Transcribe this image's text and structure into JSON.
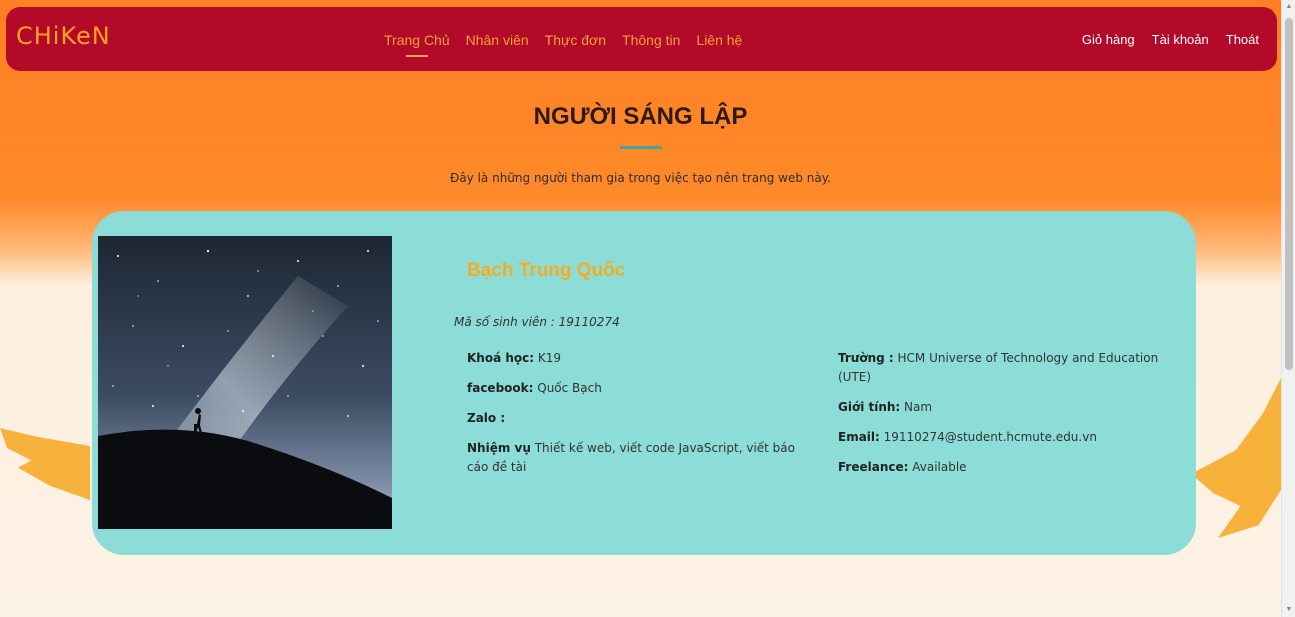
{
  "navbar": {
    "brand": "CHiKeN",
    "menu": [
      "Trang Chủ",
      "Nhân viên",
      "Thực đơn",
      "Thông tin",
      "Liên hệ"
    ],
    "right": [
      "Giỏ hàng",
      "Tài khoản",
      "Thoát"
    ]
  },
  "section": {
    "title": "NGƯỜI SÁNG LẬP",
    "subtitle": "Đây là những người tham gia trong việc tạo nên trang web này."
  },
  "member": {
    "name": "Bạch Trung Quốc",
    "student_id": "Mã số sinh viên : 19110274",
    "left": [
      {
        "label": "Khoá học:",
        "value": " K19"
      },
      {
        "label": "facebook:",
        "value": " Quốc Bạch"
      },
      {
        "label": "Zalo :",
        "value": ""
      },
      {
        "label": "Nhiệm vụ",
        "value": " Thiết kế web, viết code JavaScript, viết báo cáo đề tài"
      }
    ],
    "right": [
      {
        "label": "Trường :",
        "value": " HCM Universe of Technology and Education (UTE)"
      },
      {
        "label": "Giới tính:",
        "value": " Nam"
      },
      {
        "label": "Email:",
        "value": " 19110274@student.hcmute.edu.vn"
      },
      {
        "label": "Freelance:",
        "value": " Available"
      }
    ]
  },
  "colors": {
    "navbar": "#b20a28",
    "brand": "#ffa126",
    "card": "#8cddd8",
    "name": "#f4ad1f",
    "accent_line": "#3aa9a0"
  },
  "icons": {
    "scroll_up": "arrow-up-icon",
    "scroll_down": "arrow-down-icon"
  }
}
